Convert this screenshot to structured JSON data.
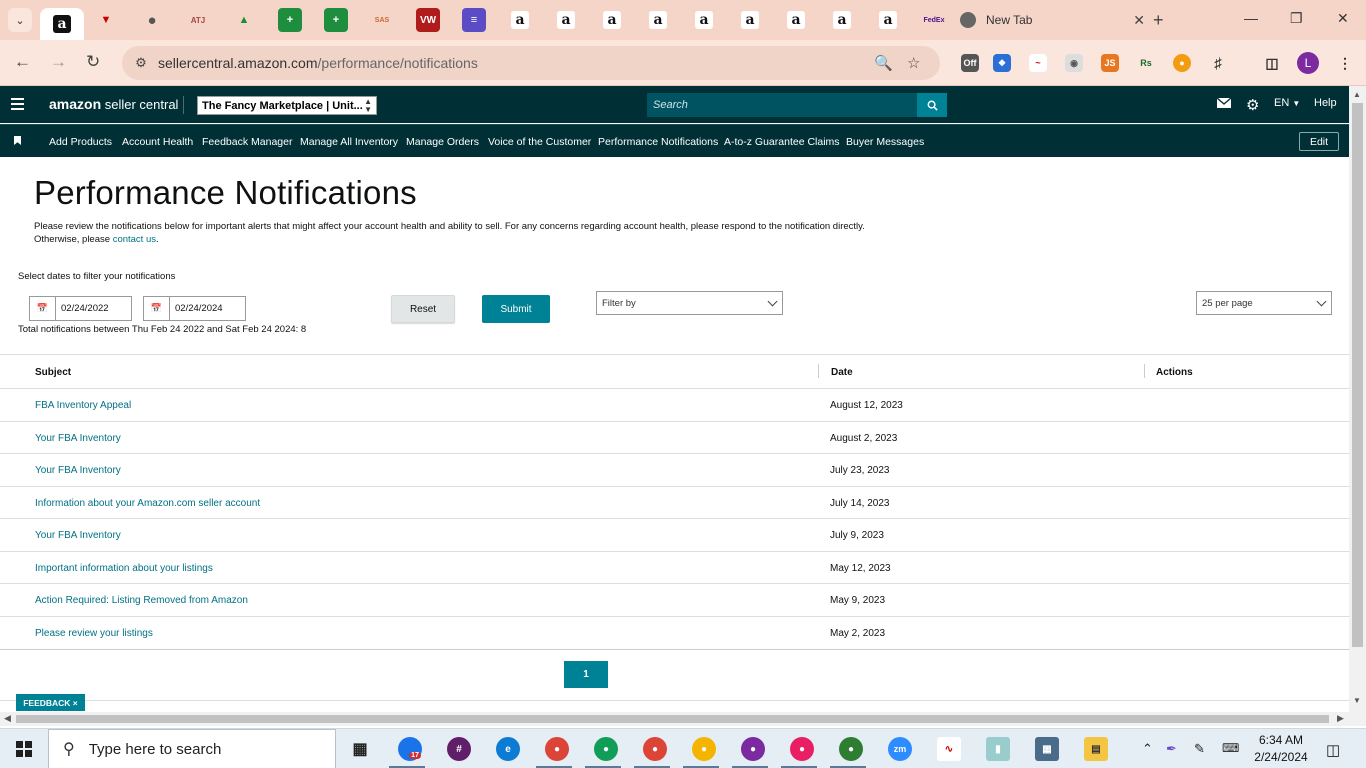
{
  "browser": {
    "new_tab_label": "New Tab",
    "url_host": "sellercentral.amazon.com",
    "url_path": "/performance/notifications",
    "profile_initial": "L"
  },
  "header": {
    "logo_brand": "amazon",
    "logo_suffix": "seller central",
    "marketplace": "The Fancy Marketplace | Unit...",
    "search_placeholder": "Search",
    "language": "EN",
    "help": "Help"
  },
  "nav": {
    "items": [
      "Add Products",
      "Account Health",
      "Feedback Manager",
      "Manage All Inventory",
      "Manage Orders",
      "Voice of the Customer",
      "Performance Notifications",
      "A-to-z Guarantee Claims",
      "Buyer Messages"
    ],
    "edit": "Edit"
  },
  "page": {
    "title": "Performance Notifications",
    "intro_line1": "Please review the notifications below for important alerts that might affect your account health and ability to sell. For any concerns regarding account health, please respond to the notification directly.",
    "intro_line2_prefix": "Otherwise, please ",
    "intro_link": "contact us",
    "intro_line2_suffix": ".",
    "filter_label": "Select dates to filter your notifications",
    "date_from": "02/24/2022",
    "date_to": "02/24/2024",
    "total_text": "Total notifications between Thu Feb 24 2022 and Sat Feb 24 2024: 8",
    "reset": "Reset",
    "submit": "Submit",
    "filter_by": "Filter by",
    "per_page": "25 per page"
  },
  "table": {
    "headers": {
      "subject": "Subject",
      "date": "Date",
      "actions": "Actions"
    },
    "rows": [
      {
        "subject": "FBA Inventory Appeal",
        "date": "August 12, 2023"
      },
      {
        "subject": "Your FBA Inventory",
        "date": "August 2, 2023"
      },
      {
        "subject": "Your FBA Inventory",
        "date": "July 23, 2023"
      },
      {
        "subject": "Information about your Amazon.com seller account",
        "date": "July 14, 2023"
      },
      {
        "subject": "Your FBA Inventory",
        "date": "July 9, 2023"
      },
      {
        "subject": "Important information about your listings",
        "date": "May 12, 2023"
      },
      {
        "subject": "Action Required: Listing Removed from Amazon",
        "date": "May 9, 2023"
      },
      {
        "subject": "Please review your listings",
        "date": "May 2, 2023"
      }
    ]
  },
  "pagination": {
    "current": "1"
  },
  "feedback": "FEEDBACK ×",
  "taskbar": {
    "search_placeholder": "Type here to search",
    "badge": "17",
    "time": "6:34 AM",
    "date": "2/24/2024"
  },
  "colors": {
    "header_bg": "#002f36",
    "accent": "#008296",
    "link": "#007185",
    "tabstrip": "#f5d5c8"
  }
}
